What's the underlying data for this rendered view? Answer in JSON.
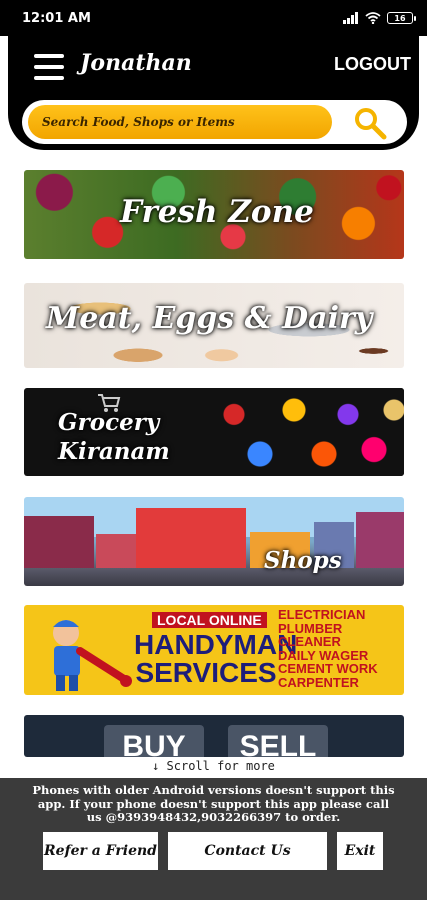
{
  "status_bar": {
    "time": "12:01 AM",
    "signal_icon": "signal-bars-icon",
    "wifi_icon": "wifi-icon",
    "battery_level": "16"
  },
  "header": {
    "username": "Jonathan",
    "logout_label": "LOGOUT",
    "search_placeholder": "Search Food, Shops or Items"
  },
  "banners": {
    "fresh_zone": "Fresh Zone",
    "meat": "Meat, Eggs & Dairy",
    "grocery_line1": "Grocery",
    "grocery_line2": "Kiranam",
    "shops": "Shops",
    "handyman": {
      "tag": "LOCAL ONLINE",
      "title_line1": "HANDYMAN",
      "title_line2": "SERVICES",
      "services": [
        "ELECTRICIAN",
        "PLUMBER",
        "CLEANER",
        "DAILY WAGER",
        "CEMENT WORK",
        "CARPENTER"
      ]
    },
    "buy": "BUY",
    "sell": "SELL"
  },
  "scroll_hint": "↓ Scroll for more",
  "footer": {
    "notice": "Phones with older Android versions doesn't support this app. If your phone doesn't support this app please call us @9393948432,9032266397 to order.",
    "refer_label": "Refer a Friend",
    "contact_label": "Contact Us",
    "exit_label": "Exit"
  },
  "colors": {
    "header_bg": "#000000",
    "search_pill": "#f5b400",
    "footer_bg": "#3b3b3b"
  }
}
